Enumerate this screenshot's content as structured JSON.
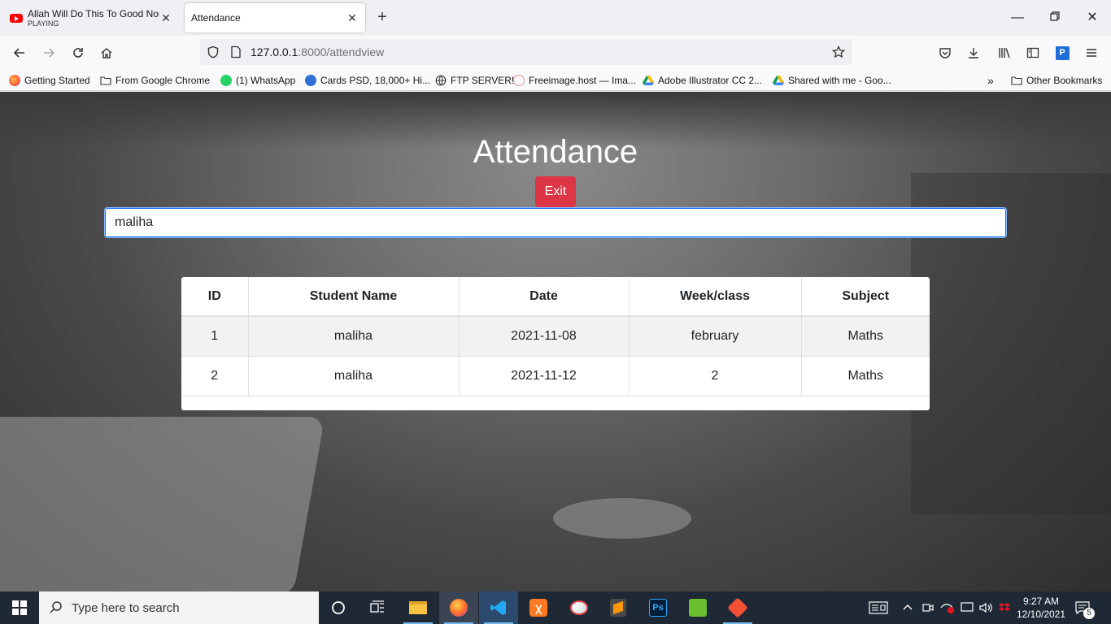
{
  "browser": {
    "tabs": [
      {
        "title": "Allah Will Do This To Good Non",
        "subtitle": "PLAYING",
        "active": false
      },
      {
        "title": "Attendance",
        "active": true
      }
    ],
    "url_host": "127.0.0.1",
    "url_path": ":8000/attendview",
    "bookmarks": [
      "Getting Started",
      "From Google Chrome",
      "(1) WhatsApp",
      "Cards PSD, 18,000+ Hi...",
      "FTP SERVER!",
      "Freeimage.host — Ima...",
      "Adobe Illustrator CC 2...",
      "Shared with me - Goo...",
      "Other Bookmarks"
    ]
  },
  "page": {
    "title": "Attendance",
    "exit_label": "Exit",
    "search_value": "maliha"
  },
  "table": {
    "headers": [
      "ID",
      "Student Name",
      "Date",
      "Week/class",
      "Subject"
    ],
    "rows": [
      [
        "1",
        "maliha",
        "2021-11-08",
        "february",
        "Maths"
      ],
      [
        "2",
        "maliha",
        "2021-11-12",
        "2",
        "Maths"
      ]
    ]
  },
  "taskbar": {
    "search_placeholder": "Type here to search",
    "time": "9:27 AM",
    "date": "12/10/2021",
    "notification_count": "5"
  },
  "colors": {
    "exit_button": "#dc3545",
    "focus_border": "#0d6efd"
  }
}
